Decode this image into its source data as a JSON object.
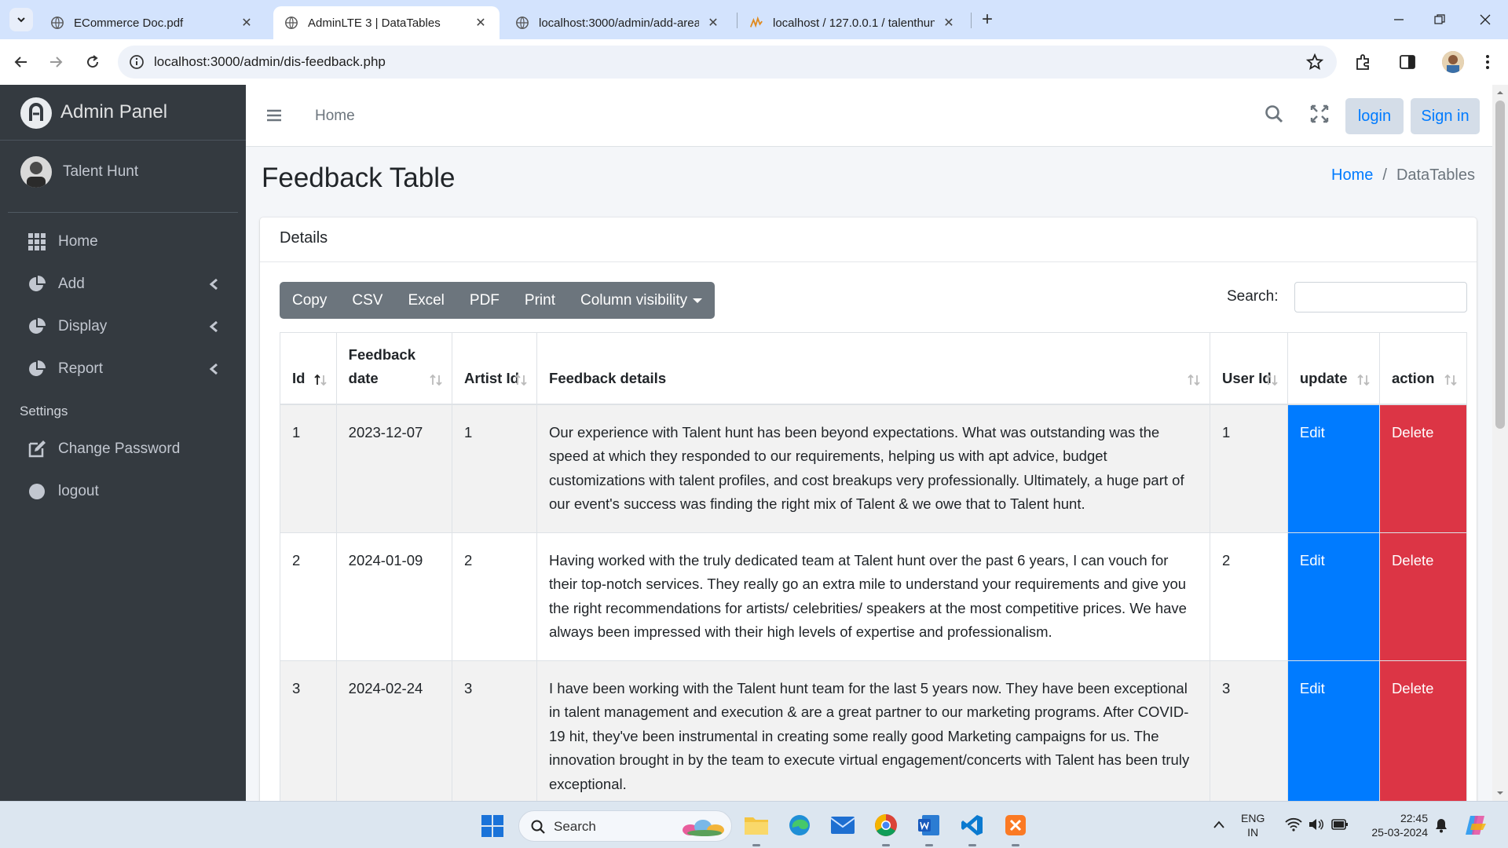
{
  "browser": {
    "tabs": [
      {
        "title": "ECommerce Doc.pdf",
        "icon": "globe-icon",
        "active": false
      },
      {
        "title": "AdminLTE 3 | DataTables",
        "icon": "globe-icon",
        "active": true
      },
      {
        "title": "localhost:3000/admin/add-area",
        "icon": "globe-icon",
        "active": false
      },
      {
        "title": "localhost / 127.0.0.1 / talenthunt",
        "icon": "phpmyadmin-icon",
        "active": false
      }
    ],
    "url": "localhost:3000/admin/dis-feedback.php"
  },
  "sidebar": {
    "brand": "Admin Panel",
    "user": "Talent Hunt",
    "items": [
      {
        "label": "Home",
        "icon": "grid-icon"
      },
      {
        "label": "Add",
        "icon": "pie-chart-icon"
      },
      {
        "label": "Display",
        "icon": "pie-chart-icon"
      },
      {
        "label": "Report",
        "icon": "pie-chart-icon"
      }
    ],
    "settings_header": "Settings",
    "settings_items": [
      {
        "label": "Change Password",
        "icon": "edit-icon"
      },
      {
        "label": "logout",
        "icon": "circle-icon"
      }
    ]
  },
  "topnav": {
    "home": "Home",
    "login": "login",
    "signin": "Sign in"
  },
  "page": {
    "title": "Feedback Table",
    "breadcrumb": {
      "home": "Home",
      "current": "DataTables"
    }
  },
  "card": {
    "title": "Details",
    "buttons": [
      "Copy",
      "CSV",
      "Excel",
      "PDF",
      "Print",
      "Column visibility"
    ],
    "search_label": "Search:",
    "search_value": ""
  },
  "table": {
    "headers": [
      "Id",
      "Feedback date",
      "Artist Id",
      "Feedback details",
      "User Id",
      "update",
      "action"
    ],
    "rows": [
      {
        "id": "1",
        "date": "2023-12-07",
        "artist_id": "1",
        "details": "Our experience with Talent hunt has been beyond expectations. What was outstanding was the speed at which they responded to our requirements, helping us with apt advice, budget customizations with talent profiles, and cost breakups very professionally. Ultimately, a huge part of our event's success was finding the right mix of Talent & we owe that to Talent hunt.",
        "user_id": "1",
        "update": "Edit",
        "action": "Delete"
      },
      {
        "id": "2",
        "date": "2024-01-09",
        "artist_id": "2",
        "details": "Having worked with the truly dedicated team at Talent hunt over the past 6 years, I can vouch for their top-notch services. They really go an extra mile to understand your requirements and give you the right recommendations for artists/ celebrities/ speakers at the most competitive prices. We have always been impressed with their high levels of expertise and professionalism.",
        "user_id": "2",
        "update": "Edit",
        "action": "Delete"
      },
      {
        "id": "3",
        "date": "2024-02-24",
        "artist_id": "3",
        "details": "I have been working with the Talent hunt team for the last 5 years now. They have been exceptional in talent management and execution & are a great partner to our marketing programs. After COVID-19 hit, they've been instrumental in creating some really good Marketing campaigns for us. The innovation brought in by the team to execute virtual engagement/concerts with Talent has been truly exceptional.",
        "user_id": "3",
        "update": "Edit",
        "action": "Delete"
      }
    ]
  },
  "taskbar": {
    "search": "Search",
    "lang": "ENG",
    "region": "IN",
    "time": "22:45",
    "date": "25-03-2024"
  }
}
